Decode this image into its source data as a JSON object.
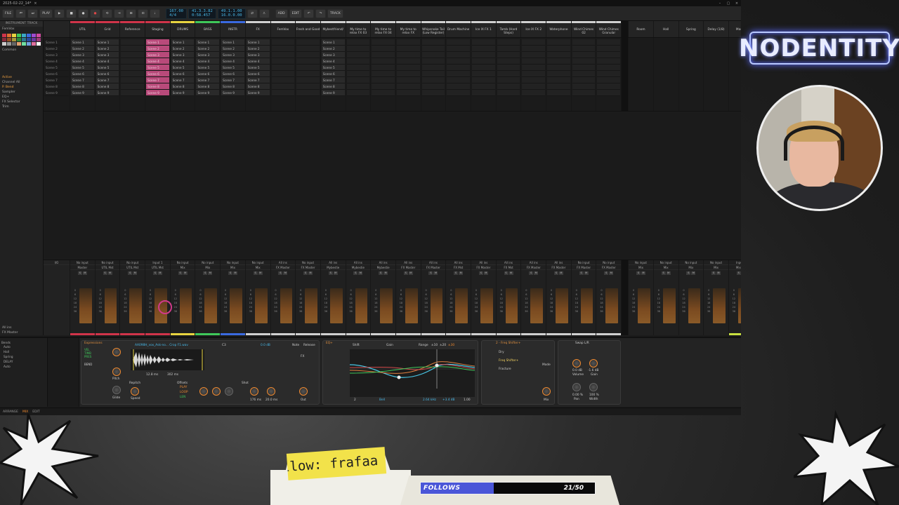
{
  "window": {
    "title": "2025-02-22_14*",
    "close": "×"
  },
  "transport": {
    "buttons": [
      "FILE",
      "⏮",
      "⏭",
      "PLAY",
      "■",
      "●"
    ],
    "tempo": "167.00",
    "signature": "4/4",
    "position": "41.3.3.82",
    "time": "0:58.457",
    "loop_start": "49.1.1.00",
    "loop_len": "16.0.0.00",
    "right_buttons": [
      "ADD",
      "EDIT",
      "↶",
      "↷",
      "TRACK"
    ]
  },
  "left_panel": {
    "header": "INSTRUMENT TRACK",
    "track_name": "FemVox",
    "preset": "Common",
    "active_label": "Active",
    "channel_label": "Channel",
    "channel_value": "All",
    "pbend_label": "P. Bend",
    "devices": [
      "Sampler",
      "EQ+",
      "FX Selector",
      "Trim"
    ],
    "routing": [
      "All ins",
      "FX Master"
    ]
  },
  "tracks": [
    {
      "name": "UTIL",
      "color": "#d0344a"
    },
    {
      "name": "Grid",
      "color": "#d0344a"
    },
    {
      "name": "Reference",
      "color": "#d0344a"
    },
    {
      "name": "Staging",
      "color": "#d0344a"
    },
    {
      "name": "DRUMS",
      "color": "#e8d440"
    },
    {
      "name": "BASS",
      "color": "#3fc85a"
    },
    {
      "name": "INSTR",
      "color": "#3a6ae0"
    },
    {
      "name": "FX",
      "color": "#d0d0d0"
    },
    {
      "name": "FemVox",
      "color": "#d0d0d0"
    },
    {
      "name": "Fresh and Good",
      "color": "#d0d0d0"
    },
    {
      "name": "Mybestfriend/",
      "color": "#d0d0d0"
    },
    {
      "name": "My time to relax FX 03",
      "color": "#d0d0d0"
    },
    {
      "name": "My time to relax FX 04",
      "color": "#d0d0d0"
    },
    {
      "name": "My time to relax FX",
      "color": "#d0d0d0"
    },
    {
      "name": "Whipsnake Tail (Low Register)",
      "color": "#d0d0d0"
    },
    {
      "name": "Drum Machine",
      "color": "#d0d0d0"
    },
    {
      "name": "Ice IX FX 1",
      "color": "#d0d0d0"
    },
    {
      "name": "Tamb (Hard Steps)",
      "color": "#d0d0d0"
    },
    {
      "name": "Ice IX FX 2",
      "color": "#d0d0d0"
    },
    {
      "name": "Waterphone",
      "color": "#d0d0d0"
    },
    {
      "name": "Wind Chimes 02",
      "color": "#d0d0d0"
    },
    {
      "name": "Wind Chimes Granular",
      "color": "#d0d0d0"
    }
  ],
  "fx_tracks": [
    {
      "name": "Room"
    },
    {
      "name": "Hall"
    },
    {
      "name": "Spring"
    },
    {
      "name": "Delay (1/8)"
    },
    {
      "name": "Master"
    }
  ],
  "scenes": [
    "Scene 1",
    "Scene 2",
    "Scene 3",
    "Scene 4",
    "Scene 5",
    "Scene 6",
    "Scene 7",
    "Scene 8",
    "Scene 9"
  ],
  "mixer": {
    "io_label": "I/O",
    "inputs": [
      "No input",
      "No input",
      "No input",
      "Input 1",
      "No input",
      "No input",
      "No input",
      "No input",
      "All ins",
      "No input",
      "All ins",
      "All ins",
      "All ins",
      "All ins",
      "All ins",
      "All ins",
      "All ins",
      "All ins",
      "All ins",
      "All ins",
      "No input",
      "No input"
    ],
    "outputs": [
      "Master",
      "UTIL Mst",
      "UTIL Mst",
      "UTIL Mst",
      "Mix",
      "Mix",
      "Mix",
      "Mix",
      "FX Master",
      "FX Master",
      "Mybestie",
      "Mybestie",
      "Mybestie",
      "FX Master",
      "FX Master",
      "FX Mst",
      "FX Master",
      "FX Mst",
      "FX Master",
      "FX Master",
      "FX Master",
      "FX Master"
    ],
    "fx_inputs": [
      "No input",
      "No input",
      "No input",
      "No input",
      "Input 1"
    ],
    "fx_outputs": [
      "Mix",
      "Mix",
      "Mix",
      "Mix",
      "Mix 3/4"
    ],
    "s": "S",
    "m": "M"
  },
  "devices": {
    "sampler": {
      "title": "Expressions",
      "labels": [
        "VEL",
        "TIMB",
        "PRES"
      ],
      "file": "AA098H_vox_Ask-no... Crop F1.wav",
      "vel_note": "C3",
      "gain": "0.0 dB",
      "freq": "12.8 ms",
      "env": "302 ms",
      "mode": "Repitch",
      "offsets": "Offsets",
      "play": "PLAY",
      "loop": "LOOP",
      "len": "LEN",
      "speed": "Speed",
      "pitch": "Pitch",
      "glide": "Glide",
      "shot": "Shot",
      "release_a": "176 ms",
      "release_b": "20.0 ms",
      "out": "Out",
      "note": "Note",
      "release": "Release",
      "fx": "FX",
      "bend": "BEND"
    },
    "eq": {
      "title": "EQ+",
      "shift": "Shift",
      "gain": "Gain",
      "range": "Range",
      "range_vals": [
        "±10",
        "±20",
        "±30"
      ],
      "band": "2",
      "type": "Bell",
      "freq": "2.64 kHz",
      "gainval": "+3.4 dB",
      "q": "1.00"
    },
    "fxselector": {
      "title": "2 - Freq Shifter+",
      "items": [
        "Dry",
        "Freq Shifter+",
        "Fracture"
      ],
      "mode": "Mode",
      "mix": "Mix"
    },
    "trim": {
      "title": "Swap L/R",
      "volume": "0.0 dB",
      "gain": "-1.6 dB",
      "pan": "0.00 %",
      "width": "100 %",
      "volume_label": "Volume",
      "gain_label": "Gain",
      "pan_label": "Pan",
      "width_label": "Width"
    }
  },
  "statusbar": {
    "tabs": [
      "ARRANGE",
      "MIX",
      "EDIT"
    ]
  },
  "overlay": {
    "logo": "NODENTITY",
    "follow_label": "llow: frafaa",
    "goal_label": "FOLLOWS",
    "goal_count": "21/50",
    "goal_progress": 0.42
  },
  "colors": {
    "accent": "#f08a30",
    "goal_fill": "#4a56d8",
    "neon": "#b8c8ff"
  }
}
